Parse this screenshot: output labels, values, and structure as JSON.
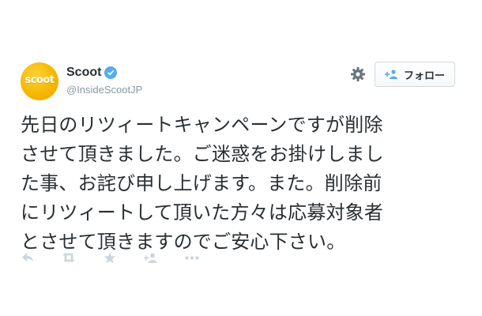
{
  "profile": {
    "avatar_label": "scoot",
    "display_name": "Scoot",
    "handle": "@InsideScootJP",
    "verified": true
  },
  "follow_button": {
    "label": "フォロー"
  },
  "tweet": {
    "text": "先日のリツィートキャンペーンですが削除\nさせて頂きました。ご迷惑をお掛けしまし\nた事、お詫び申し上げます。また。削除前\nにリツィートして頂いた方々は応募対象者\nとさせて頂きますのでご安心下さい。"
  },
  "icons": {
    "settings": "gear-icon",
    "verified": "verified-badge-icon",
    "follow": "person-add-icon",
    "actions": [
      "reply-icon",
      "retweet-icon",
      "favorite-star-icon",
      "follow-icon",
      "more-dots-icon"
    ]
  },
  "colors": {
    "brand_yellow": "#f5b800",
    "verified_blue": "#55acee",
    "text": "#292f33",
    "muted": "#8899a6",
    "action_icons": "#ccd6dd"
  }
}
